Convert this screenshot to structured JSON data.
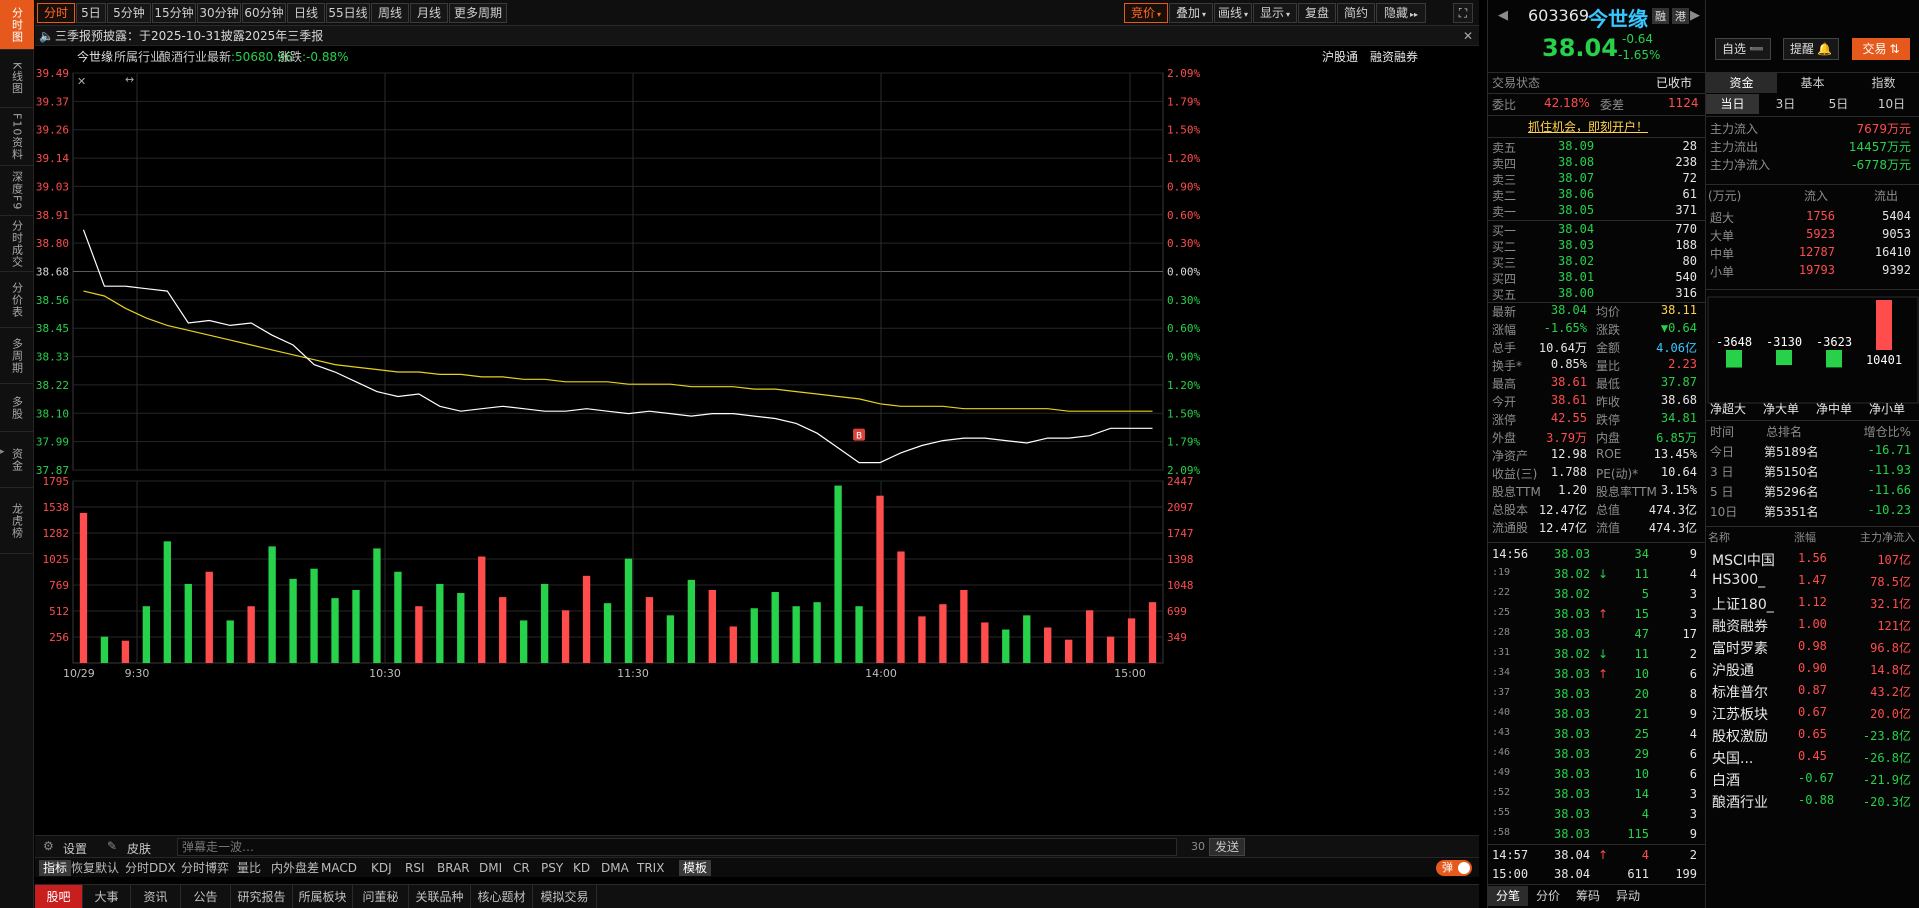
{
  "leftnav": [
    "分时图",
    "K线图",
    "F10资料",
    "深度F9",
    "分时成交",
    "分价表",
    "多周期",
    "多股",
    "资金",
    "龙虎榜"
  ],
  "toolbar": {
    "periods": [
      "分时",
      "5日",
      "5分钟",
      "15分钟",
      "30分钟",
      "60分钟",
      "日线",
      "55日线",
      "周线",
      "月线",
      "更多周期"
    ],
    "right": [
      "竞价",
      "叠加",
      "画线",
      "显示",
      "复盘",
      "简约",
      "隐藏"
    ]
  },
  "notice": {
    "text": "三季报预披露：于2025-10-31披露2025年三季报"
  },
  "info": {
    "name": "今世缘",
    "industry_label": "所属行业",
    "industry": "酿酒行业",
    "latest_label": "最新",
    "latest": "50680.96",
    "change_label": "涨跌",
    "change": "-0.88%",
    "hgt": "沪股通",
    "rzrq": "融资融券"
  },
  "price_axis": {
    "left": [
      "39.49",
      "39.37",
      "39.26",
      "39.14",
      "39.03",
      "38.91",
      "38.80",
      "38.68",
      "38.56",
      "38.45",
      "38.33",
      "38.22",
      "38.10",
      "37.99",
      "37.87"
    ],
    "right": [
      "2.09%",
      "1.79%",
      "1.50%",
      "1.20%",
      "0.90%",
      "0.60%",
      "0.30%",
      "0.00%",
      "0.30%",
      "0.60%",
      "0.90%",
      "1.20%",
      "1.50%",
      "1.79%",
      "2.09%"
    ]
  },
  "vol_axis": {
    "left": [
      "1795",
      "1538",
      "1282",
      "1025",
      "769",
      "512",
      "256"
    ],
    "right": [
      "2447",
      "2097",
      "1747",
      "1398",
      "1048",
      "699",
      "349"
    ]
  },
  "time_axis": [
    "10/29",
    "9:30",
    "10:30",
    "11:30",
    "14:00",
    "15:00"
  ],
  "chart_data": {
    "type": "line",
    "title": "",
    "price_range": [
      37.87,
      39.49
    ],
    "prev_close": 38.68,
    "volume_range": [
      0,
      1795
    ],
    "price_series": [
      38.85,
      38.62,
      38.62,
      38.61,
      38.6,
      38.47,
      38.48,
      38.46,
      38.47,
      38.42,
      38.38,
      38.3,
      38.27,
      38.23,
      38.19,
      38.17,
      38.18,
      38.13,
      38.11,
      38.12,
      38.13,
      38.12,
      38.11,
      38.11,
      38.12,
      38.11,
      38.1,
      38.11,
      38.1,
      38.09,
      38.1,
      38.1,
      38.09,
      38.08,
      38.06,
      38.02,
      37.96,
      37.9,
      37.9,
      37.94,
      37.97,
      37.99,
      38.0,
      38.0,
      37.99,
      37.98,
      38.0,
      38.0,
      38.01,
      38.04,
      38.04,
      38.04
    ],
    "avg_series": [
      38.6,
      38.58,
      38.53,
      38.49,
      38.46,
      38.44,
      38.42,
      38.4,
      38.38,
      38.36,
      38.34,
      38.32,
      38.3,
      38.29,
      38.28,
      38.27,
      38.27,
      38.26,
      38.26,
      38.25,
      38.25,
      38.24,
      38.24,
      38.23,
      38.23,
      38.23,
      38.22,
      38.22,
      38.22,
      38.21,
      38.21,
      38.21,
      38.2,
      38.2,
      38.19,
      38.18,
      38.17,
      38.16,
      38.14,
      38.13,
      38.13,
      38.13,
      38.12,
      38.12,
      38.12,
      38.12,
      38.12,
      38.11,
      38.11,
      38.11,
      38.11,
      38.11
    ],
    "volume": [
      1480,
      260,
      220,
      560,
      1200,
      780,
      900,
      420,
      560,
      1150,
      830,
      930,
      640,
      720,
      1130,
      900,
      560,
      780,
      690,
      1050,
      650,
      420,
      780,
      520,
      860,
      590,
      1030,
      650,
      470,
      820,
      720,
      360,
      540,
      700,
      560,
      600,
      1750,
      560,
      1650,
      1100,
      460,
      580,
      720,
      400,
      330,
      470,
      350,
      230,
      520,
      260,
      440,
      600
    ]
  },
  "input": {
    "placeholder": "弹幕走一波…",
    "count": "30",
    "send": "发送",
    "settings": "设置",
    "skin": "皮肤"
  },
  "indicators": [
    "指标",
    "恢复默认",
    "分时DDX",
    "分时博弈",
    "量比",
    "内外盘差",
    "MACD",
    "KDJ",
    "RSI",
    "BRAR",
    "DMI",
    "CR",
    "PSY",
    "KD",
    "DMA",
    "TRIX",
    "模板"
  ],
  "danmu_toggle": "弹",
  "bottomnav": [
    "股吧",
    "大事",
    "资讯",
    "公告",
    "研究报告",
    "所属板块",
    "问董秘",
    "关联品种",
    "核心题材",
    "模拟交易"
  ],
  "quote": {
    "code": "603369",
    "name": "今世缘",
    "price": "38.04",
    "change": "-0.64",
    "pct": "-1.65%",
    "tags": [
      "融",
      "港"
    ],
    "status_label": "交易状态",
    "status": "已收市",
    "wb_label": "委比",
    "wb": "42.18%",
    "wc_label": "委差",
    "wc": "1124",
    "ad": "抓住机会，即刻开户！",
    "sell": [
      {
        "l": "卖五",
        "p": "38.09",
        "v": "28"
      },
      {
        "l": "卖四",
        "p": "38.08",
        "v": "238"
      },
      {
        "l": "卖三",
        "p": "38.07",
        "v": "72"
      },
      {
        "l": "卖二",
        "p": "38.06",
        "v": "61"
      },
      {
        "l": "卖一",
        "p": "38.05",
        "v": "371"
      }
    ],
    "buy": [
      {
        "l": "买一",
        "p": "38.04",
        "v": "770"
      },
      {
        "l": "买二",
        "p": "38.03",
        "v": "188"
      },
      {
        "l": "买三",
        "p": "38.02",
        "v": "80"
      },
      {
        "l": "买四",
        "p": "38.01",
        "v": "540"
      },
      {
        "l": "买五",
        "p": "38.00",
        "v": "316"
      }
    ],
    "stats": [
      [
        "最新",
        "38.04",
        "均价",
        "38.11"
      ],
      [
        "涨幅",
        "-1.65%",
        "涨跌",
        "▼0.64"
      ],
      [
        "总手",
        "10.64万",
        "金额",
        "4.06亿"
      ],
      [
        "换手*",
        "0.85%",
        "量比",
        "2.23"
      ],
      [
        "最高",
        "38.61",
        "最低",
        "37.87"
      ],
      [
        "今开",
        "38.61",
        "昨收",
        "38.68"
      ],
      [
        "涨停",
        "42.55",
        "跌停",
        "34.81"
      ],
      [
        "外盘",
        "3.79万",
        "内盘",
        "6.85万"
      ],
      [
        "净资产",
        "12.98",
        "ROE",
        "13.45%"
      ],
      [
        "收益(三)",
        "1.788",
        "PE(动)*",
        "10.64"
      ],
      [
        "股息TTM",
        "1.20",
        "股息率TTM",
        "3.15%"
      ],
      [
        "总股本",
        "12.47亿",
        "总值",
        "474.3亿"
      ],
      [
        "流通股",
        "12.47亿",
        "流值",
        "474.3亿"
      ]
    ],
    "ticks": [
      [
        "14:56",
        "38.03",
        "34",
        "9"
      ],
      [
        ":19",
        "38.02",
        "11",
        "4"
      ],
      [
        ":22",
        "38.02",
        "5",
        "3"
      ],
      [
        ":25",
        "38.03",
        "15",
        "3"
      ],
      [
        ":28",
        "38.03",
        "47",
        "17"
      ],
      [
        ":31",
        "38.02",
        "11",
        "2"
      ],
      [
        ":34",
        "38.03",
        "10",
        "6"
      ],
      [
        ":37",
        "38.03",
        "20",
        "8"
      ],
      [
        ":40",
        "38.03",
        "21",
        "9"
      ],
      [
        ":43",
        "38.03",
        "25",
        "4"
      ],
      [
        ":46",
        "38.03",
        "29",
        "6"
      ],
      [
        ":49",
        "38.03",
        "10",
        "6"
      ],
      [
        ":52",
        "38.03",
        "14",
        "3"
      ],
      [
        ":55",
        "38.03",
        "4",
        "3"
      ],
      [
        ":58",
        "38.03",
        "115",
        "9"
      ],
      [
        "14:57",
        "38.04",
        "4",
        "2"
      ],
      [
        "15:00",
        "38.04",
        "611",
        "199"
      ]
    ],
    "tick_arrows": [
      "",
      "↓",
      "",
      "↑",
      "",
      "↓",
      "↑",
      "",
      "",
      "",
      "",
      "",
      "",
      "",
      "",
      "↑",
      ""
    ],
    "bottomtabs": [
      "分笔",
      "分价",
      "筹码",
      "异动"
    ]
  },
  "fund": {
    "zixuan": "自选",
    "remind": "提醒",
    "trade": "交易",
    "tabs": [
      "资金",
      "基本",
      "指数"
    ],
    "periods": [
      "当日",
      "3日",
      "5日",
      "10日"
    ],
    "main": [
      [
        "主力流入",
        "7679万元"
      ],
      [
        "主力流出",
        "14457万元"
      ],
      [
        "主力净流入",
        "-6778万元"
      ]
    ],
    "unit": "(万元)",
    "in": "流入",
    "out": "流出",
    "sizes": [
      [
        "超大",
        "1756",
        "5404"
      ],
      [
        "大单",
        "5923",
        "9053"
      ],
      [
        "中单",
        "12787",
        "16410"
      ],
      [
        "小单",
        "19793",
        "9392"
      ]
    ],
    "net": [
      "-3648",
      "-3130",
      "-3623",
      "10401"
    ],
    "net_labels": [
      "净超大",
      "净大单",
      "净中单",
      "净小单"
    ],
    "rank_head": [
      "时间",
      "总排名",
      "增仓比%"
    ],
    "rank": [
      [
        "今日",
        "第5189名",
        "-16.71"
      ],
      [
        "3 日",
        "第5150名",
        "-11.93"
      ],
      [
        "5 日",
        "第5296名",
        "-11.66"
      ],
      [
        "10日",
        "第5351名",
        "-10.23"
      ]
    ],
    "sector_head": [
      "名称",
      "涨幅",
      "主力净流入"
    ],
    "sectors": [
      [
        "MSCI中国",
        "1.56",
        "107亿"
      ],
      [
        "HS300_",
        "1.47",
        "78.5亿"
      ],
      [
        "上证180_",
        "1.12",
        "32.1亿"
      ],
      [
        "融资融券",
        "1.00",
        "121亿"
      ],
      [
        "富时罗素",
        "0.98",
        "96.8亿"
      ],
      [
        "沪股通",
        "0.90",
        "14.8亿"
      ],
      [
        "标准普尔",
        "0.87",
        "43.2亿"
      ],
      [
        "江苏板块",
        "0.67",
        "20.0亿"
      ],
      [
        "股权激励",
        "0.65",
        "-23.8亿"
      ],
      [
        "央国...",
        "0.45",
        "-26.8亿"
      ],
      [
        "白酒",
        "-0.67",
        "-21.9亿"
      ],
      [
        "酿酒行业",
        "-0.88",
        "-20.3亿"
      ]
    ]
  },
  "colors": {
    "up": "#ff4d4d",
    "down": "#27d14a",
    "accent": "#e55a1c",
    "price_line": "#ffffff",
    "avg_line": "#e6d21c"
  },
  "icons": [
    "close-icon",
    "speaker-icon",
    "gear-icon",
    "skin-icon",
    "chevron-left-icon",
    "chevron-right-icon",
    "bell-icon"
  ]
}
